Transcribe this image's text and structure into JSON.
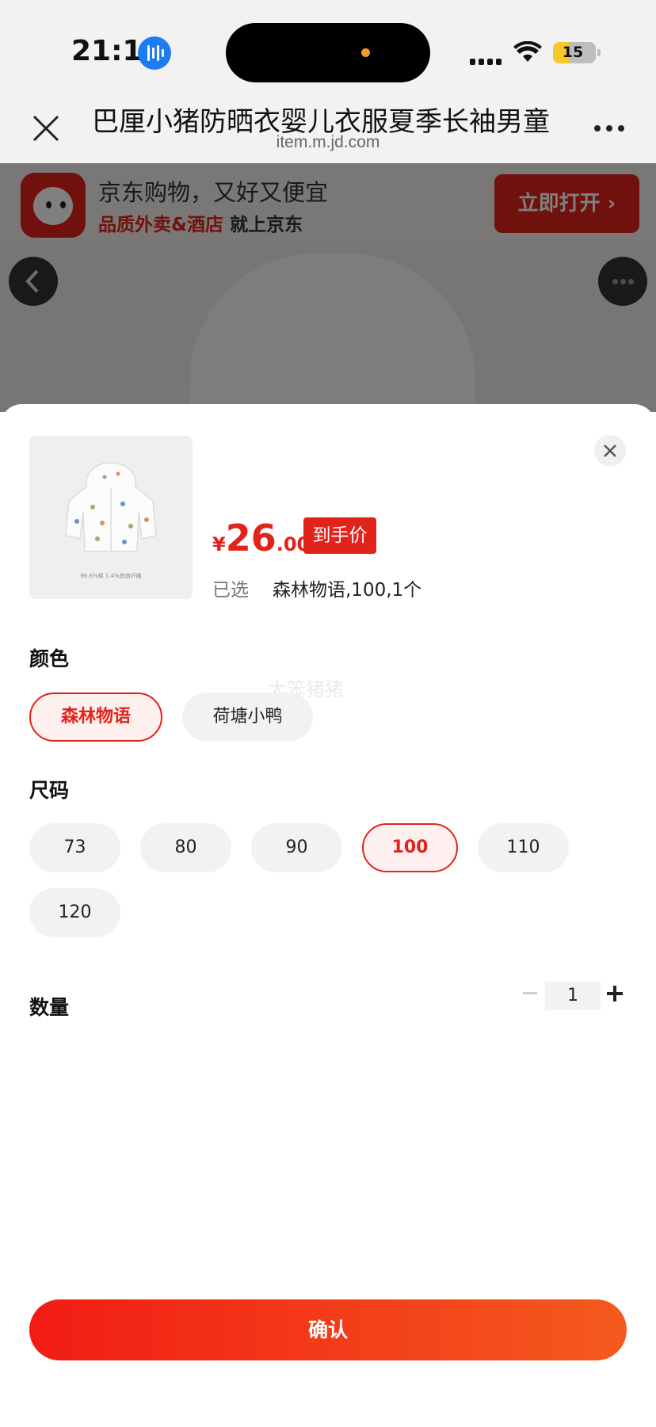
{
  "status_bar": {
    "time": "21:11",
    "battery": "15"
  },
  "browser": {
    "page_title": "巴厘小猪防晒衣婴儿衣服夏季长袖男童",
    "url": "item.m.jd.com"
  },
  "banner": {
    "slogan": "京东购物，又好又便宜",
    "tagline_red": "品质外卖&酒店",
    "tagline_dark": " 就上京东",
    "open_button": "立即打开"
  },
  "product": {
    "thumb_caption": "96.6%棉 1.4%其他纤维",
    "currency": "¥",
    "price_int": "26",
    "price_dec": ".00",
    "price_tag": "到手价",
    "selected_label": "已选",
    "selected_value": "森林物语,100,1个"
  },
  "watermark": "大笨猪猪",
  "color_section": {
    "label": "颜色",
    "options": [
      "森林物语",
      "荷塘小鸭"
    ],
    "selected": "森林物语"
  },
  "size_section": {
    "label": "尺码",
    "options": [
      "73",
      "80",
      "90",
      "100",
      "110",
      "120"
    ],
    "selected": "100"
  },
  "quantity_section": {
    "label": "数量",
    "value": "1"
  },
  "confirm_button": "确认",
  "colors": {
    "accent": "#e2231a",
    "chip_bg": "#f2f2f2"
  }
}
